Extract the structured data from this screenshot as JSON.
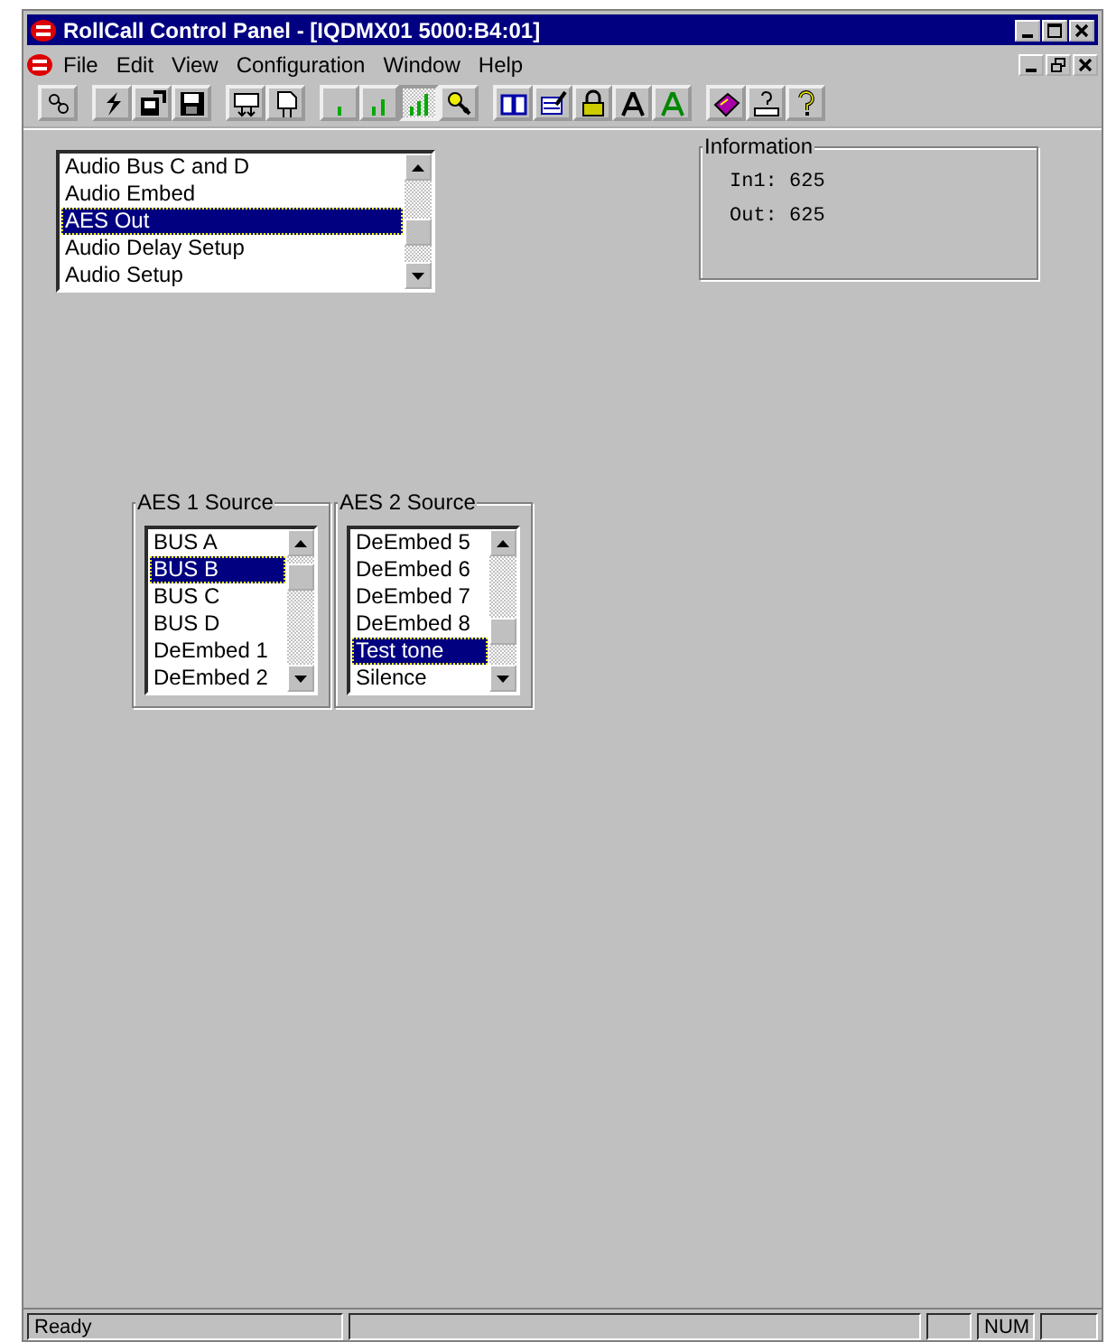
{
  "window": {
    "title": "RollCall Control Panel - [IQDMX01 5000:B4:01]"
  },
  "menu": [
    "File",
    "Edit",
    "View",
    "Configuration",
    "Window",
    "Help"
  ],
  "toolbar": [
    {
      "buttons": [
        {
          "kind": "link",
          "selected": false
        }
      ]
    },
    {
      "buttons": [
        {
          "kind": "flash",
          "selected": false
        },
        {
          "kind": "export",
          "selected": false
        },
        {
          "kind": "save",
          "selected": false
        }
      ]
    },
    {
      "buttons": [
        {
          "kind": "download",
          "selected": false
        },
        {
          "kind": "file-down",
          "selected": false
        }
      ]
    },
    {
      "buttons": [
        {
          "kind": "bars1",
          "selected": false
        },
        {
          "kind": "bars2",
          "selected": false
        },
        {
          "kind": "bars3",
          "selected": true
        },
        {
          "kind": "key",
          "selected": false
        }
      ]
    },
    {
      "buttons": [
        {
          "kind": "book",
          "selected": false
        },
        {
          "kind": "edit",
          "selected": false
        },
        {
          "kind": "lock",
          "selected": false
        },
        {
          "kind": "font",
          "selected": false
        },
        {
          "kind": "font-green",
          "selected": false
        }
      ]
    },
    {
      "buttons": [
        {
          "kind": "manual",
          "selected": false
        },
        {
          "kind": "help-kbd",
          "selected": false
        },
        {
          "kind": "help",
          "selected": false
        }
      ]
    }
  ],
  "page_list": {
    "items": [
      {
        "label": "Audio Bus C and D",
        "selected": false
      },
      {
        "label": "Audio Embed",
        "selected": false
      },
      {
        "label": "AES Out",
        "selected": true
      },
      {
        "label": "Audio Delay Setup",
        "selected": false
      },
      {
        "label": "Audio Setup",
        "selected": false
      }
    ]
  },
  "information": {
    "title": "Information",
    "lines": [
      "In1: 625",
      "Out: 625"
    ]
  },
  "sources": [
    {
      "title": "AES 1 Source",
      "items": [
        {
          "label": "BUS A",
          "selected": false
        },
        {
          "label": "BUS B",
          "selected": true
        },
        {
          "label": "BUS C",
          "selected": false
        },
        {
          "label": "BUS D",
          "selected": false
        },
        {
          "label": "DeEmbed 1",
          "selected": false
        },
        {
          "label": "DeEmbed 2",
          "selected": false
        }
      ]
    },
    {
      "title": "AES 2 Source",
      "items": [
        {
          "label": "DeEmbed 5",
          "selected": false
        },
        {
          "label": "DeEmbed 6",
          "selected": false
        },
        {
          "label": "DeEmbed 7",
          "selected": false
        },
        {
          "label": "DeEmbed 8",
          "selected": false
        },
        {
          "label": "Test tone",
          "selected": true
        },
        {
          "label": "Silence",
          "selected": false
        }
      ]
    }
  ],
  "status_bar": {
    "message": "Ready",
    "indicators": [
      "NUM"
    ]
  }
}
